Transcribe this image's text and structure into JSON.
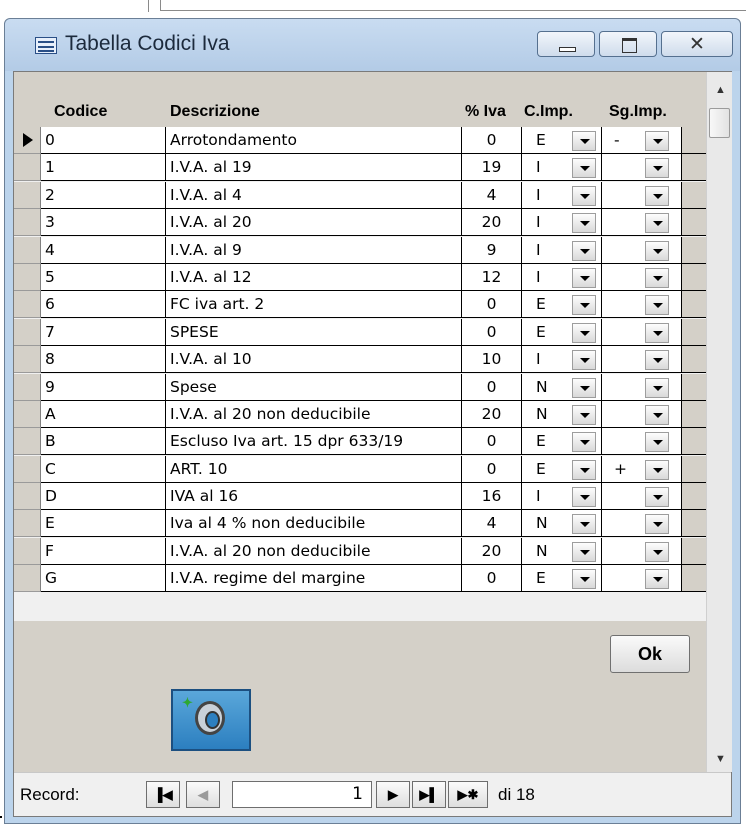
{
  "window": {
    "title": "Tabella Codici Iva",
    "close_glyph": "✕"
  },
  "columns": {
    "codice": "Codice",
    "descrizione": "Descrizione",
    "iva": "% Iva",
    "cimp": "C.Imp.",
    "sgimp": "Sg.Imp."
  },
  "rows": [
    {
      "codice": "0",
      "descrizione": "Arrotondamento",
      "iva": "0",
      "cimp": "E",
      "sgimp": "-"
    },
    {
      "codice": "1",
      "descrizione": "I.V.A. al 19",
      "iva": "19",
      "cimp": "I",
      "sgimp": ""
    },
    {
      "codice": "2",
      "descrizione": "I.V.A. al 4",
      "iva": "4",
      "cimp": "I",
      "sgimp": ""
    },
    {
      "codice": "3",
      "descrizione": "I.V.A. al 20",
      "iva": "20",
      "cimp": "I",
      "sgimp": ""
    },
    {
      "codice": "4",
      "descrizione": "I.V.A. al 9",
      "iva": "9",
      "cimp": "I",
      "sgimp": ""
    },
    {
      "codice": "5",
      "descrizione": "I.V.A. al 12",
      "iva": "12",
      "cimp": "I",
      "sgimp": ""
    },
    {
      "codice": "6",
      "descrizione": "FC iva art. 2",
      "iva": "0",
      "cimp": "E",
      "sgimp": ""
    },
    {
      "codice": "7",
      "descrizione": "SPESE",
      "iva": "0",
      "cimp": "E",
      "sgimp": ""
    },
    {
      "codice": "8",
      "descrizione": "I.V.A. al 10",
      "iva": "10",
      "cimp": "I",
      "sgimp": ""
    },
    {
      "codice": "9",
      "descrizione": "Spese",
      "iva": "0",
      "cimp": "N",
      "sgimp": ""
    },
    {
      "codice": "A",
      "descrizione": "I.V.A. al 20  non deducibile",
      "iva": "20",
      "cimp": "N",
      "sgimp": ""
    },
    {
      "codice": "B",
      "descrizione": "Escluso Iva art. 15 dpr 633/19",
      "iva": "0",
      "cimp": "E",
      "sgimp": ""
    },
    {
      "codice": "C",
      "descrizione": "ART. 10",
      "iva": "0",
      "cimp": "E",
      "sgimp": "+"
    },
    {
      "codice": "D",
      "descrizione": "IVA al 16",
      "iva": "16",
      "cimp": "I",
      "sgimp": ""
    },
    {
      "codice": "E",
      "descrizione": "Iva al 4 % non deducibile",
      "iva": "4",
      "cimp": "N",
      "sgimp": ""
    },
    {
      "codice": "F",
      "descrizione": "I.V.A. al 20 non deducibile",
      "iva": "20",
      "cimp": "N",
      "sgimp": ""
    },
    {
      "codice": "G",
      "descrizione": "I.V.A. regime del margine",
      "iva": "0",
      "cimp": "E",
      "sgimp": ""
    }
  ],
  "footer": {
    "ok_label": "Ok",
    "key_icon": "key-icon"
  },
  "navigation": {
    "label": "Record:",
    "current": "1",
    "total": "di 18",
    "first_glyph": "▐◀",
    "prev_glyph": "◀",
    "next_glyph": "▶",
    "last_glyph": "▶▌",
    "new_glyph": "▶✱"
  },
  "colors": {
    "window_frame": "#bcd4ec",
    "datasheet_header": "#d4d0c8",
    "key_button": "#2c7fc0"
  }
}
